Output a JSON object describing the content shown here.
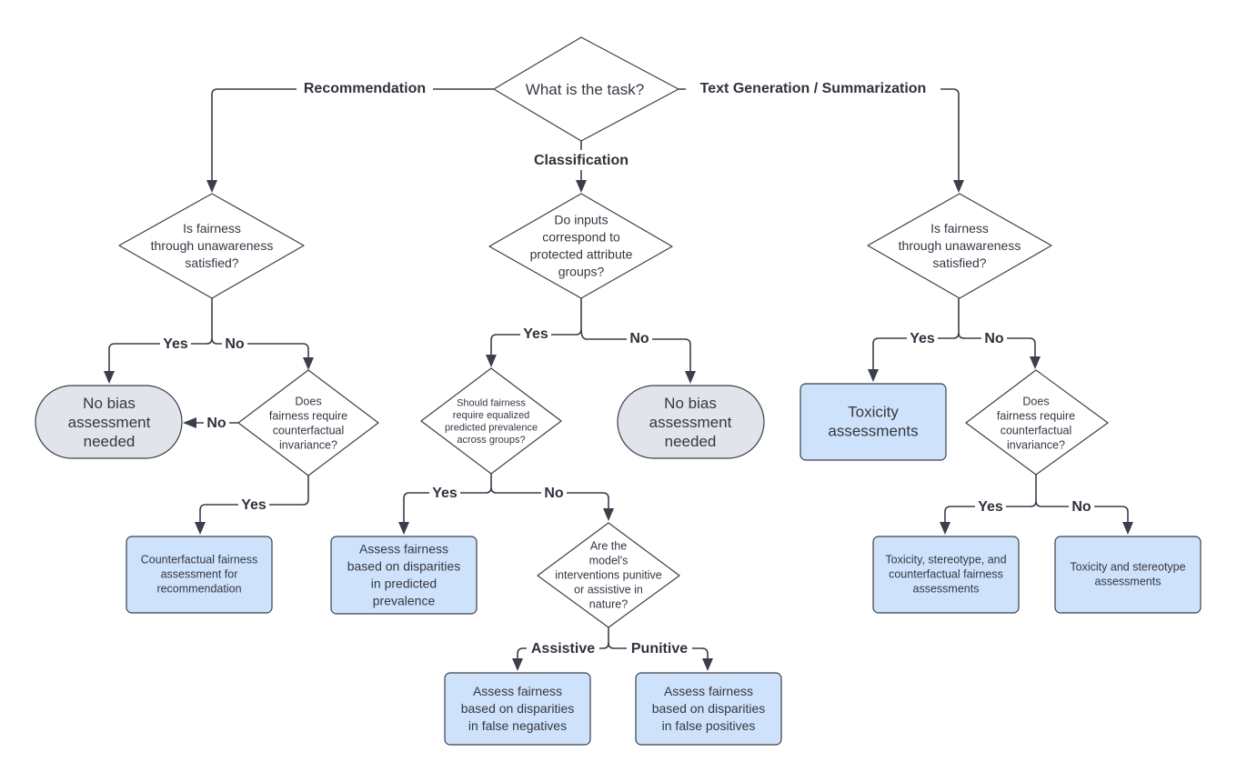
{
  "diagram": {
    "root": {
      "text": [
        "What is the task?"
      ]
    },
    "branches": {
      "recommendation": "Recommendation",
      "classification": "Classification",
      "text_generation": "Text Generation / Summarization"
    },
    "recommendation": {
      "q1": {
        "text": [
          "Is fairness",
          "through unawareness",
          "satisfied?"
        ]
      },
      "q1_yes": "Yes",
      "q1_no": "No",
      "no_bias": {
        "text": [
          "No bias",
          "assessment",
          "needed"
        ]
      },
      "q2": {
        "text": [
          "Does",
          "fairness require",
          "counterfactual",
          "invariance?"
        ]
      },
      "q2_no": "No",
      "q2_yes": "Yes",
      "result": {
        "text": [
          "Counterfactual fairness",
          "assessment for",
          "recommendation"
        ]
      }
    },
    "classification": {
      "q1": {
        "text": [
          "Do inputs",
          "correspond to",
          "protected attribute",
          "groups?"
        ]
      },
      "q1_yes": "Yes",
      "q1_no": "No",
      "no_bias": {
        "text": [
          "No bias",
          "assessment",
          "needed"
        ]
      },
      "q2": {
        "text": [
          "Should fairness",
          "require equalized",
          "predicted prevalence",
          "across groups?"
        ]
      },
      "q2_yes": "Yes",
      "q2_no": "No",
      "prevalence": {
        "text": [
          "Assess fairness",
          "based on disparities",
          "in predicted",
          "prevalence"
        ]
      },
      "q3": {
        "text": [
          "Are the",
          "model's",
          "interventions punitive",
          "or assistive in",
          "nature?"
        ]
      },
      "q3_assistive": "Assistive",
      "q3_punitive": "Punitive",
      "false_negatives": {
        "text": [
          "Assess fairness",
          "based on disparities",
          "in false negatives"
        ]
      },
      "false_positives": {
        "text": [
          "Assess fairness",
          "based on disparities",
          "in false positives"
        ]
      }
    },
    "text_generation": {
      "q1": {
        "text": [
          "Is fairness",
          "through unawareness",
          "satisfied?"
        ]
      },
      "q1_yes": "Yes",
      "q1_no": "No",
      "toxicity": {
        "text": [
          "Toxicity",
          "assessments"
        ]
      },
      "q2": {
        "text": [
          "Does",
          "fairness require",
          "counterfactual",
          "invariance?"
        ]
      },
      "q2_yes": "Yes",
      "q2_no": "No",
      "tox_stereo_cf": {
        "text": [
          "Toxicity, stereotype, and",
          "counterfactual fairness",
          "assessments"
        ]
      },
      "tox_stereo": {
        "text": [
          "Toxicity and stereotype",
          "assessments"
        ]
      }
    }
  },
  "colors": {
    "line": "#3a3f4b",
    "decision_fill": "#ffffff",
    "terminal_fill": "#e1e4ea",
    "outcome_fill": "#cfe2fb",
    "text": "#333842"
  }
}
